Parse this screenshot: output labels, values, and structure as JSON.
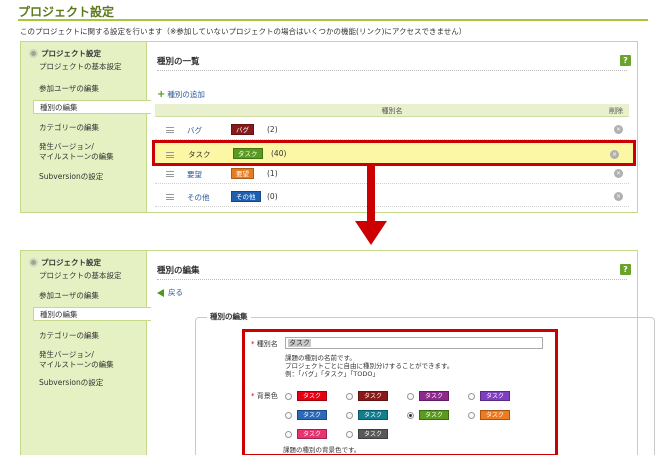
{
  "page": {
    "title": "プロジェクト設定",
    "description": "このプロジェクトに関する設定を行います（※参加していないプロジェクトの場合はいくつかの機能(リンク)にアクセスできません）"
  },
  "sidebar": {
    "heading": "プロジェクト設定",
    "items": [
      {
        "label": "プロジェクトの基本設定"
      },
      {
        "label": "参加ユーザの編集"
      },
      {
        "label": "種別の編集"
      },
      {
        "label": "カテゴリーの編集"
      },
      {
        "label": "発生バージョン/"
      },
      {
        "label": "マイルストーンの編集"
      },
      {
        "label": "Subversionの設定"
      }
    ],
    "active": "種別の編集"
  },
  "list_panel": {
    "title": "種別の一覧",
    "help_label": "?",
    "add_label": "種別の追加",
    "col_name": "種別名",
    "col_delete": "削除",
    "delete_symbol": "×",
    "rows": [
      {
        "name": "バグ",
        "badge": "バグ",
        "color": "#8a1a1a",
        "count": "(2)"
      },
      {
        "name": "タスク",
        "badge": "タスク",
        "color": "#5a9a1e",
        "count": "(40)"
      },
      {
        "name": "要望",
        "badge": "要望",
        "color": "#e87b1e",
        "count": "(1)"
      },
      {
        "name": "その他",
        "badge": "その他",
        "color": "#1f5fb0",
        "count": "(0)"
      }
    ]
  },
  "edit_panel": {
    "title": "種別の編集",
    "help_label": "?",
    "back_label": "戻る",
    "fieldset_legend": "種別の編集",
    "required_mark": "*",
    "name_label": "種別名",
    "name_value": "タスク",
    "name_help_1": "課題の種別の名前です。",
    "name_help_2": "プロジェクトごとに自由に種別分けすることができます。",
    "name_help_3": "例：「バグ」「タスク」「TODO」",
    "color_label": "背景色",
    "color_help": "課題の種別の背景色です。",
    "swatch_label": "タスク",
    "colors": [
      {
        "hex": "#e60012",
        "checked": false
      },
      {
        "hex": "#8a1a1a",
        "checked": false
      },
      {
        "hex": "#8b2a8b",
        "checked": false
      },
      {
        "hex": "#7f3fbf",
        "checked": false
      },
      {
        "hex": "#2a6ab8",
        "checked": false
      },
      {
        "hex": "#0f7f8f",
        "checked": false
      },
      {
        "hex": "#5a9a1e",
        "checked": true
      },
      {
        "hex": "#f07a1e",
        "checked": false
      },
      {
        "hex": "#e8336f",
        "checked": false
      },
      {
        "hex": "#595959",
        "checked": false
      }
    ]
  }
}
